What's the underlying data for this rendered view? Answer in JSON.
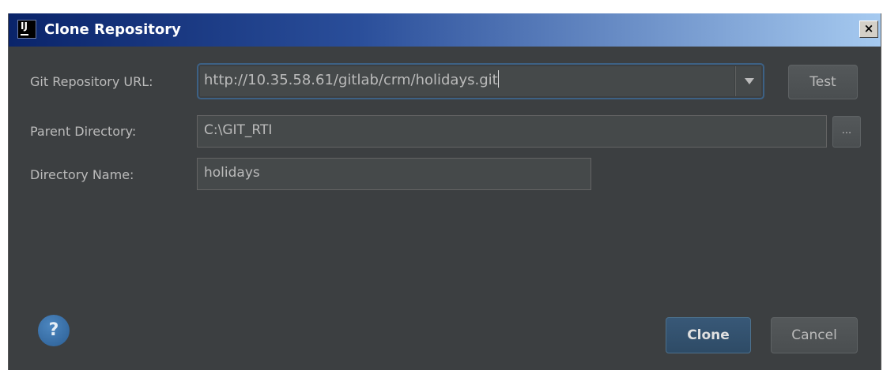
{
  "window": {
    "title": "Clone Repository",
    "app_icon_text": "IJ",
    "close_glyph": "×"
  },
  "form": {
    "url_label": "Git Repository URL:",
    "url_value": "http://10.35.58.61/gitlab/crm/holidays.git",
    "test_label": "Test",
    "parent_label": "Parent Directory:",
    "parent_value": "C:\\GIT_RTI",
    "browse_label": "...",
    "name_label": "Directory Name:",
    "name_value": "holidays"
  },
  "footer": {
    "help_glyph": "?",
    "clone_label": "Clone",
    "cancel_label": "Cancel"
  },
  "icons": {
    "app": "intellij-icon",
    "close": "close-icon",
    "dropdown": "chevron-down-icon",
    "help": "help-icon"
  },
  "colors": {
    "background": "#3c3f41",
    "titlebar_start": "#0a246a",
    "titlebar_end": "#a6caf0",
    "focus_border": "#3d6185",
    "default_button": "#385877",
    "text": "#bbbbbb"
  }
}
